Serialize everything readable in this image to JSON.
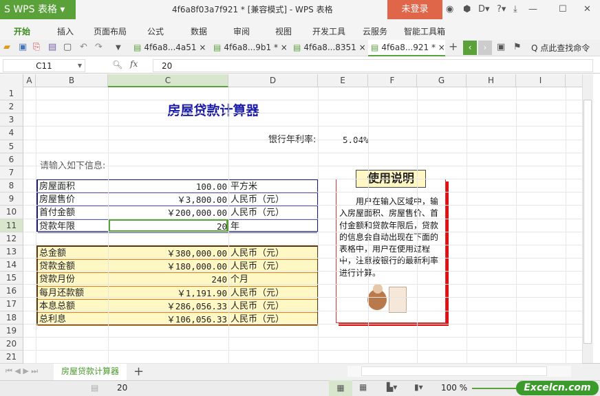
{
  "app": {
    "logo": "S WPS 表格 ▾",
    "doc_title": "4f6a8f03a7f921 * [兼容模式] - WPS 表格",
    "login": "未登录",
    "window_icons": [
      "◉",
      "⬢",
      "D▾",
      "?▾",
      "⤓",
      "—",
      "☐",
      "✕"
    ]
  },
  "menu": [
    "开始",
    "插入",
    "页面布局",
    "公式",
    "数据",
    "审阅",
    "视图",
    "开发工具",
    "云服务",
    "智能工具箱"
  ],
  "doc_tabs": [
    {
      "label": "4f6a8...4a51 ×"
    },
    {
      "label": "4f6a8...9b1 * ×"
    },
    {
      "label": "4f6a8...8351 ×"
    },
    {
      "label": "4f6a8...921 * ×",
      "active": true
    }
  ],
  "search_command": "Q 点此查找命令",
  "formula_bar": {
    "name_box": "C11",
    "fx": "fx",
    "value": "20"
  },
  "columns": [
    "A",
    "B",
    "C",
    "D",
    "E",
    "F",
    "G",
    "H",
    "I"
  ],
  "rows": [
    "1",
    "2",
    "3",
    "4",
    "5",
    "6",
    "7",
    "8",
    "9",
    "10",
    "11",
    "12",
    "13",
    "14",
    "15",
    "16",
    "17",
    "18",
    "19",
    "20",
    "21"
  ],
  "sheet": {
    "title": "房屋贷款计算器",
    "rate_label": "银行年利率:",
    "rate_value": "5.04%",
    "prompt": "请输入如下信息:",
    "inputs": [
      {
        "label": "房屋面积",
        "value": "100.00",
        "unit": "平方米"
      },
      {
        "label": "房屋售价",
        "value": "￥3,800.00",
        "unit": "人民币（元）"
      },
      {
        "label": "首付金额",
        "value": "￥200,000.00",
        "unit": "人民币（元）"
      },
      {
        "label": "贷款年限",
        "value": "20",
        "unit": "年"
      }
    ],
    "results": [
      {
        "label": "总金额",
        "value": "￥380,000.00",
        "unit": "人民币（元）"
      },
      {
        "label": "贷款金额",
        "value": "￥180,000.00",
        "unit": "人民币（元）"
      },
      {
        "label": "贷款月份",
        "value": "240",
        "unit": "个月"
      },
      {
        "label": "每月还款额",
        "value": "￥1,191.90",
        "unit": "人民币（元）"
      },
      {
        "label": "本息总额",
        "value": "￥286,056.33",
        "unit": "人民币（元）"
      },
      {
        "label": "总利息",
        "value": "￥106,056.33",
        "unit": "人民币（元）"
      }
    ],
    "instructions_title": "使用说明",
    "instructions_text": "用户在输入区域中，输入房屋面积、房屋售价、首付金额和贷款年限后，贷款的信息会自动出现在下面的表格中，用户在使用过程中，注意按银行的最新利率进行计算。"
  },
  "sheet_tab": "房屋贷款计算器",
  "status": {
    "value": "20",
    "zoom": "100 %",
    "watermark": "Excelcn.com"
  },
  "colors": {
    "accent": "#5aa13a",
    "login": "#e0664a",
    "title_blue": "#1a1aa8",
    "result_fill": "#fff8c4"
  }
}
